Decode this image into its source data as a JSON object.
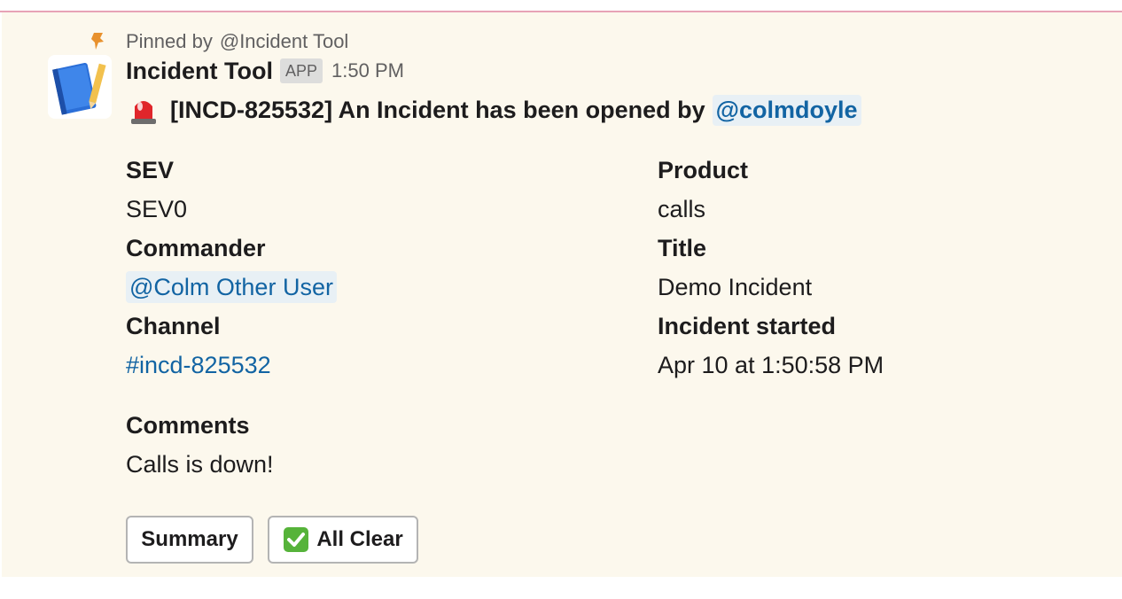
{
  "pinned": {
    "prefix": "Pinned by",
    "by": "@Incident Tool",
    "icon": "pin-icon"
  },
  "message": {
    "sender": "Incident Tool",
    "badge": "APP",
    "time": "1:50 PM",
    "avatar_icon": "notebook-pencil-icon",
    "headline_icon": "rotating-light-icon",
    "headline_text": "[INCD-825532] An Incident has been opened by",
    "headline_mention": "@colmdoyle"
  },
  "fields": {
    "sev_label": "SEV",
    "sev_value": "SEV0",
    "product_label": "Product",
    "product_value": "calls",
    "commander_label": "Commander",
    "commander_value": "@Colm Other User",
    "title_label": "Title",
    "title_value": "Demo Incident",
    "channel_label": "Channel",
    "channel_value": "#incd-825532",
    "started_label": "Incident started",
    "started_value": "Apr 10 at 1:50:58 PM",
    "comments_label": "Comments",
    "comments_value": "Calls is down!"
  },
  "actions": {
    "summary_label": "Summary",
    "all_clear_label": "All Clear",
    "all_clear_icon": "white-check-mark-icon"
  },
  "colors": {
    "highlight_bg": "#fcf8ed",
    "link": "#1264a3",
    "mention_bg": "#e8f0f5",
    "divider": "#e7a3b6"
  }
}
